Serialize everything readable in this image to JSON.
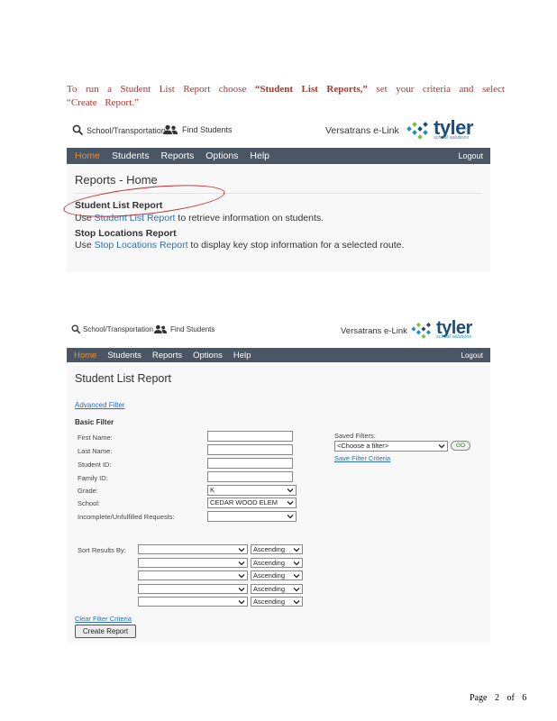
{
  "instruction": {
    "prefix": "To run a Student List Report choose ",
    "quoted": "“Student List Reports,”",
    "suffix": " set your criteria and select “Create Report.”"
  },
  "header": {
    "school_transportation": "School/Transportation",
    "find_students": "Find Students",
    "product_name": "Versatrans e-Link",
    "logo_word": "tyler",
    "logo_sub": "school solutions"
  },
  "nav": {
    "items": [
      "Home",
      "Students",
      "Reports",
      "Options",
      "Help"
    ],
    "logout": "Logout"
  },
  "reports_home": {
    "title": "Reports - Home",
    "student_list_heading": "Student List Report",
    "student_list_pre": "Use ",
    "student_list_link": "Student List Report",
    "student_list_post": " to retrieve information on students.",
    "stop_locations_heading": "Stop Locations Report",
    "stop_locations_pre": "Use ",
    "stop_locations_link": "Stop Locations Report",
    "stop_locations_post": " to display key stop information for a selected route."
  },
  "student_list": {
    "title": "Student List Report",
    "advanced_filter": "Advanced Filter",
    "basic_filter": "Basic Filter",
    "fields": {
      "first_name": "First Name:",
      "last_name": "Last Name:",
      "student_id": "Student ID:",
      "family_id": "Family ID:",
      "grade": "Grade:",
      "school": "School:",
      "incomplete": "Incomplete/Unfulfilled Requests:"
    },
    "grade_value": "K",
    "school_value": "CEDAR WOOD ELEM",
    "saved_filters_label": "Saved Filters:",
    "saved_filters_value": "<Choose a filter>",
    "go_label": "GO",
    "save_filter_criteria": "Save Filter Criteria",
    "sort_results_by": "Sort Results By:",
    "sort_order": [
      "Ascending",
      "Ascending",
      "Ascending",
      "Ascending",
      "Ascending"
    ],
    "clear_filter_criteria": "Clear Filter Criteria",
    "create_report": "Create Report"
  },
  "footer": {
    "page_label": "Page",
    "page_number": "2",
    "of_label": "of",
    "page_total": "6"
  }
}
